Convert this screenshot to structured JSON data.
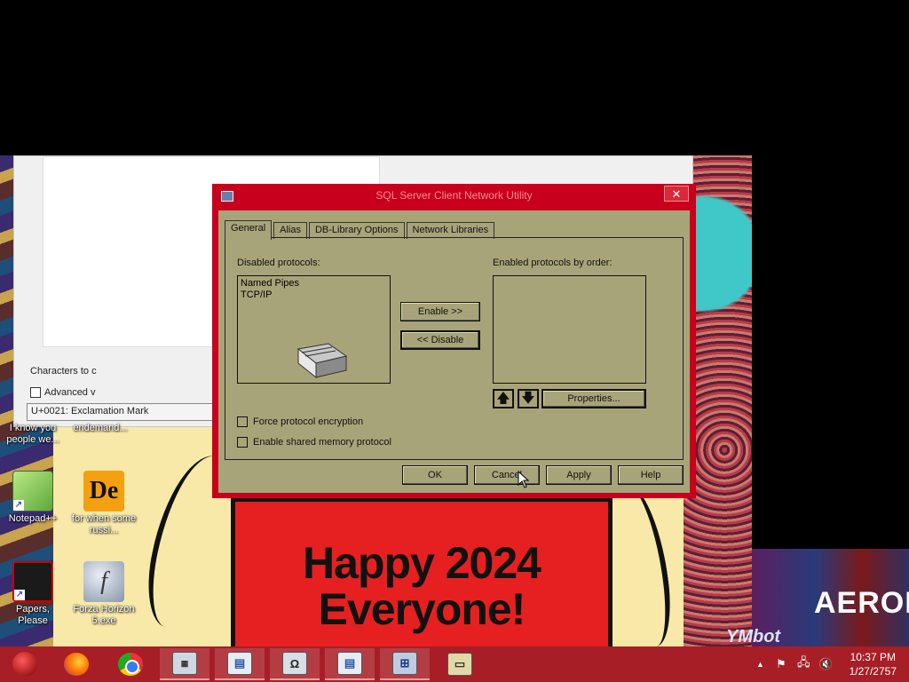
{
  "wallpaper": {
    "greeting": "Happy 2024 Everyone!",
    "sign": "AEROPOS",
    "watermark": "YMbot"
  },
  "background_window": {
    "characters_label": "Characters to c",
    "advanced_label": "Advanced v",
    "status": "U+0021: Exclamation Mark"
  },
  "desktop_icons": [
    {
      "label": "I know you people we...",
      "name": "desktop-icon-i-know-you"
    },
    {
      "label": "endemand...",
      "name": "desktop-icon-endemand"
    },
    {
      "label": "Notepad++",
      "glyph": "",
      "name": "desktop-icon-notepadpp"
    },
    {
      "label": "for when some russi...",
      "glyph": "De",
      "name": "desktop-icon-for-when"
    },
    {
      "label": "Papers, Please",
      "glyph": "",
      "name": "desktop-icon-papers-please"
    },
    {
      "label": "Forza Horizon 5.exe",
      "glyph": "f",
      "name": "desktop-icon-forza"
    }
  ],
  "dialog": {
    "title": "SQL Server Client Network Utility",
    "close_glyph": "✕",
    "tabs": [
      {
        "label": "General",
        "active": true
      },
      {
        "label": "Alias",
        "active": false
      },
      {
        "label": "DB-Library Options",
        "active": false
      },
      {
        "label": "Network Libraries",
        "active": false
      }
    ],
    "disabled_label": "Disabled protocols:",
    "enabled_label": "Enabled protocols by order:",
    "disabled_protocols": [
      "Named Pipes",
      "TCP/IP"
    ],
    "enabled_protocols": [],
    "enable_button": "Enable >>",
    "disable_button": "<< Disable",
    "up_glyph": "🡅",
    "down_glyph": "🡇",
    "properties_button": "Properties...",
    "force_encryption_label": "Force protocol encryption",
    "shared_memory_label": "Enable shared memory protocol",
    "ok_button": "OK",
    "cancel_button": "Cancel",
    "apply_button": "Apply",
    "help_button": "Help"
  },
  "taskbar": {
    "items": [
      {
        "name": "start-button",
        "icon": "start-orb-icon"
      },
      {
        "name": "taskbar-firefox",
        "icon": "firefox-icon"
      },
      {
        "name": "taskbar-chrome",
        "icon": "chrome-icon"
      },
      {
        "name": "taskbar-calculator",
        "icon": "calculator-icon"
      },
      {
        "name": "taskbar-window",
        "icon": "window-icon"
      },
      {
        "name": "taskbar-charmap",
        "icon": "charmap-icon"
      },
      {
        "name": "taskbar-window-2",
        "icon": "window-icon"
      },
      {
        "name": "taskbar-sql-utility",
        "icon": "sql-network-icon"
      },
      {
        "name": "taskbar-drive",
        "icon": "drive-icon"
      }
    ],
    "tray_glyphs": {
      "chevron": "▲",
      "flag": "⚑",
      "network": "🖧",
      "volume": "🔇"
    },
    "time": "10:37 PM",
    "date": "1/27/2757"
  },
  "colors": {
    "dialog_frame": "#c8001e",
    "dialog_body": "#a8a479",
    "taskbar": "#a81e26"
  }
}
